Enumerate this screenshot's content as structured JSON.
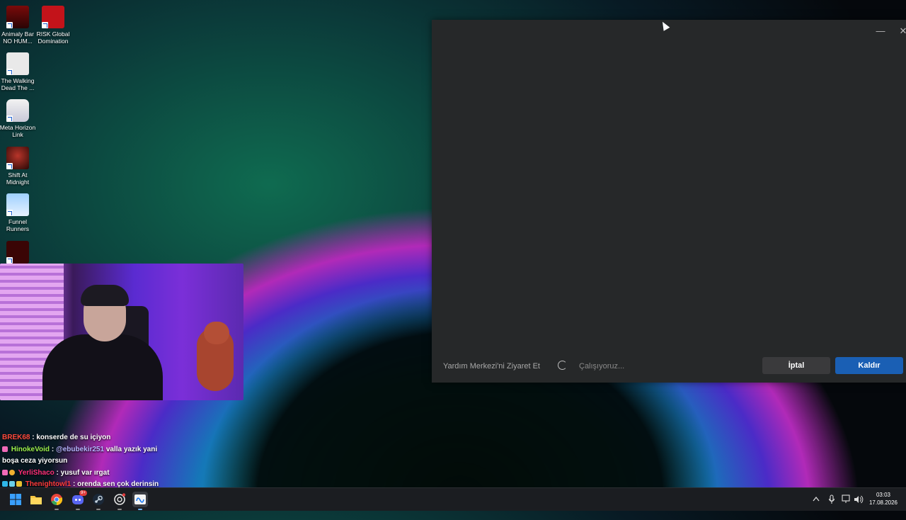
{
  "desktop": {
    "icons": [
      {
        "label": "Animaly Bar NO HUM..."
      },
      {
        "label": "RISK Global Domination"
      },
      {
        "label": "The Walking Dead The ..."
      },
      {
        "label": "Meta Horizon Link"
      },
      {
        "label": "Shift At Midnight"
      },
      {
        "label": "Funnel Runners"
      }
    ]
  },
  "chat": {
    "messages": [
      {
        "user": "BREK68",
        "text": ": konserde de su içiyon"
      },
      {
        "user": "HinokeVoid",
        "sep": " : ",
        "mention": "@ebubekir251",
        "text": " valla yazık yani"
      },
      {
        "cont": "boşa ceza yiyorsun"
      },
      {
        "user": "YerliShaco",
        "text": " : yusuf var ırgat"
      },
      {
        "user": "Thenightowl1",
        "text": " : orenda sen çok derinsin"
      }
    ]
  },
  "dialog": {
    "help_link": "Yardım Merkezi'ni Ziyaret Et",
    "status": "Çalışıyoruz...",
    "cancel_label": "İptal",
    "remove_label": "Kaldır",
    "minimize_glyph": "—",
    "close_glyph": "✕"
  },
  "taskbar": {
    "time": "03:03",
    "date": "17.08.2026",
    "discord_badge": "9+"
  },
  "colors": {
    "primary_button": "#1a5fb4",
    "dialog_bg": "#262829",
    "taskbar_bg": "#1b1d21"
  }
}
